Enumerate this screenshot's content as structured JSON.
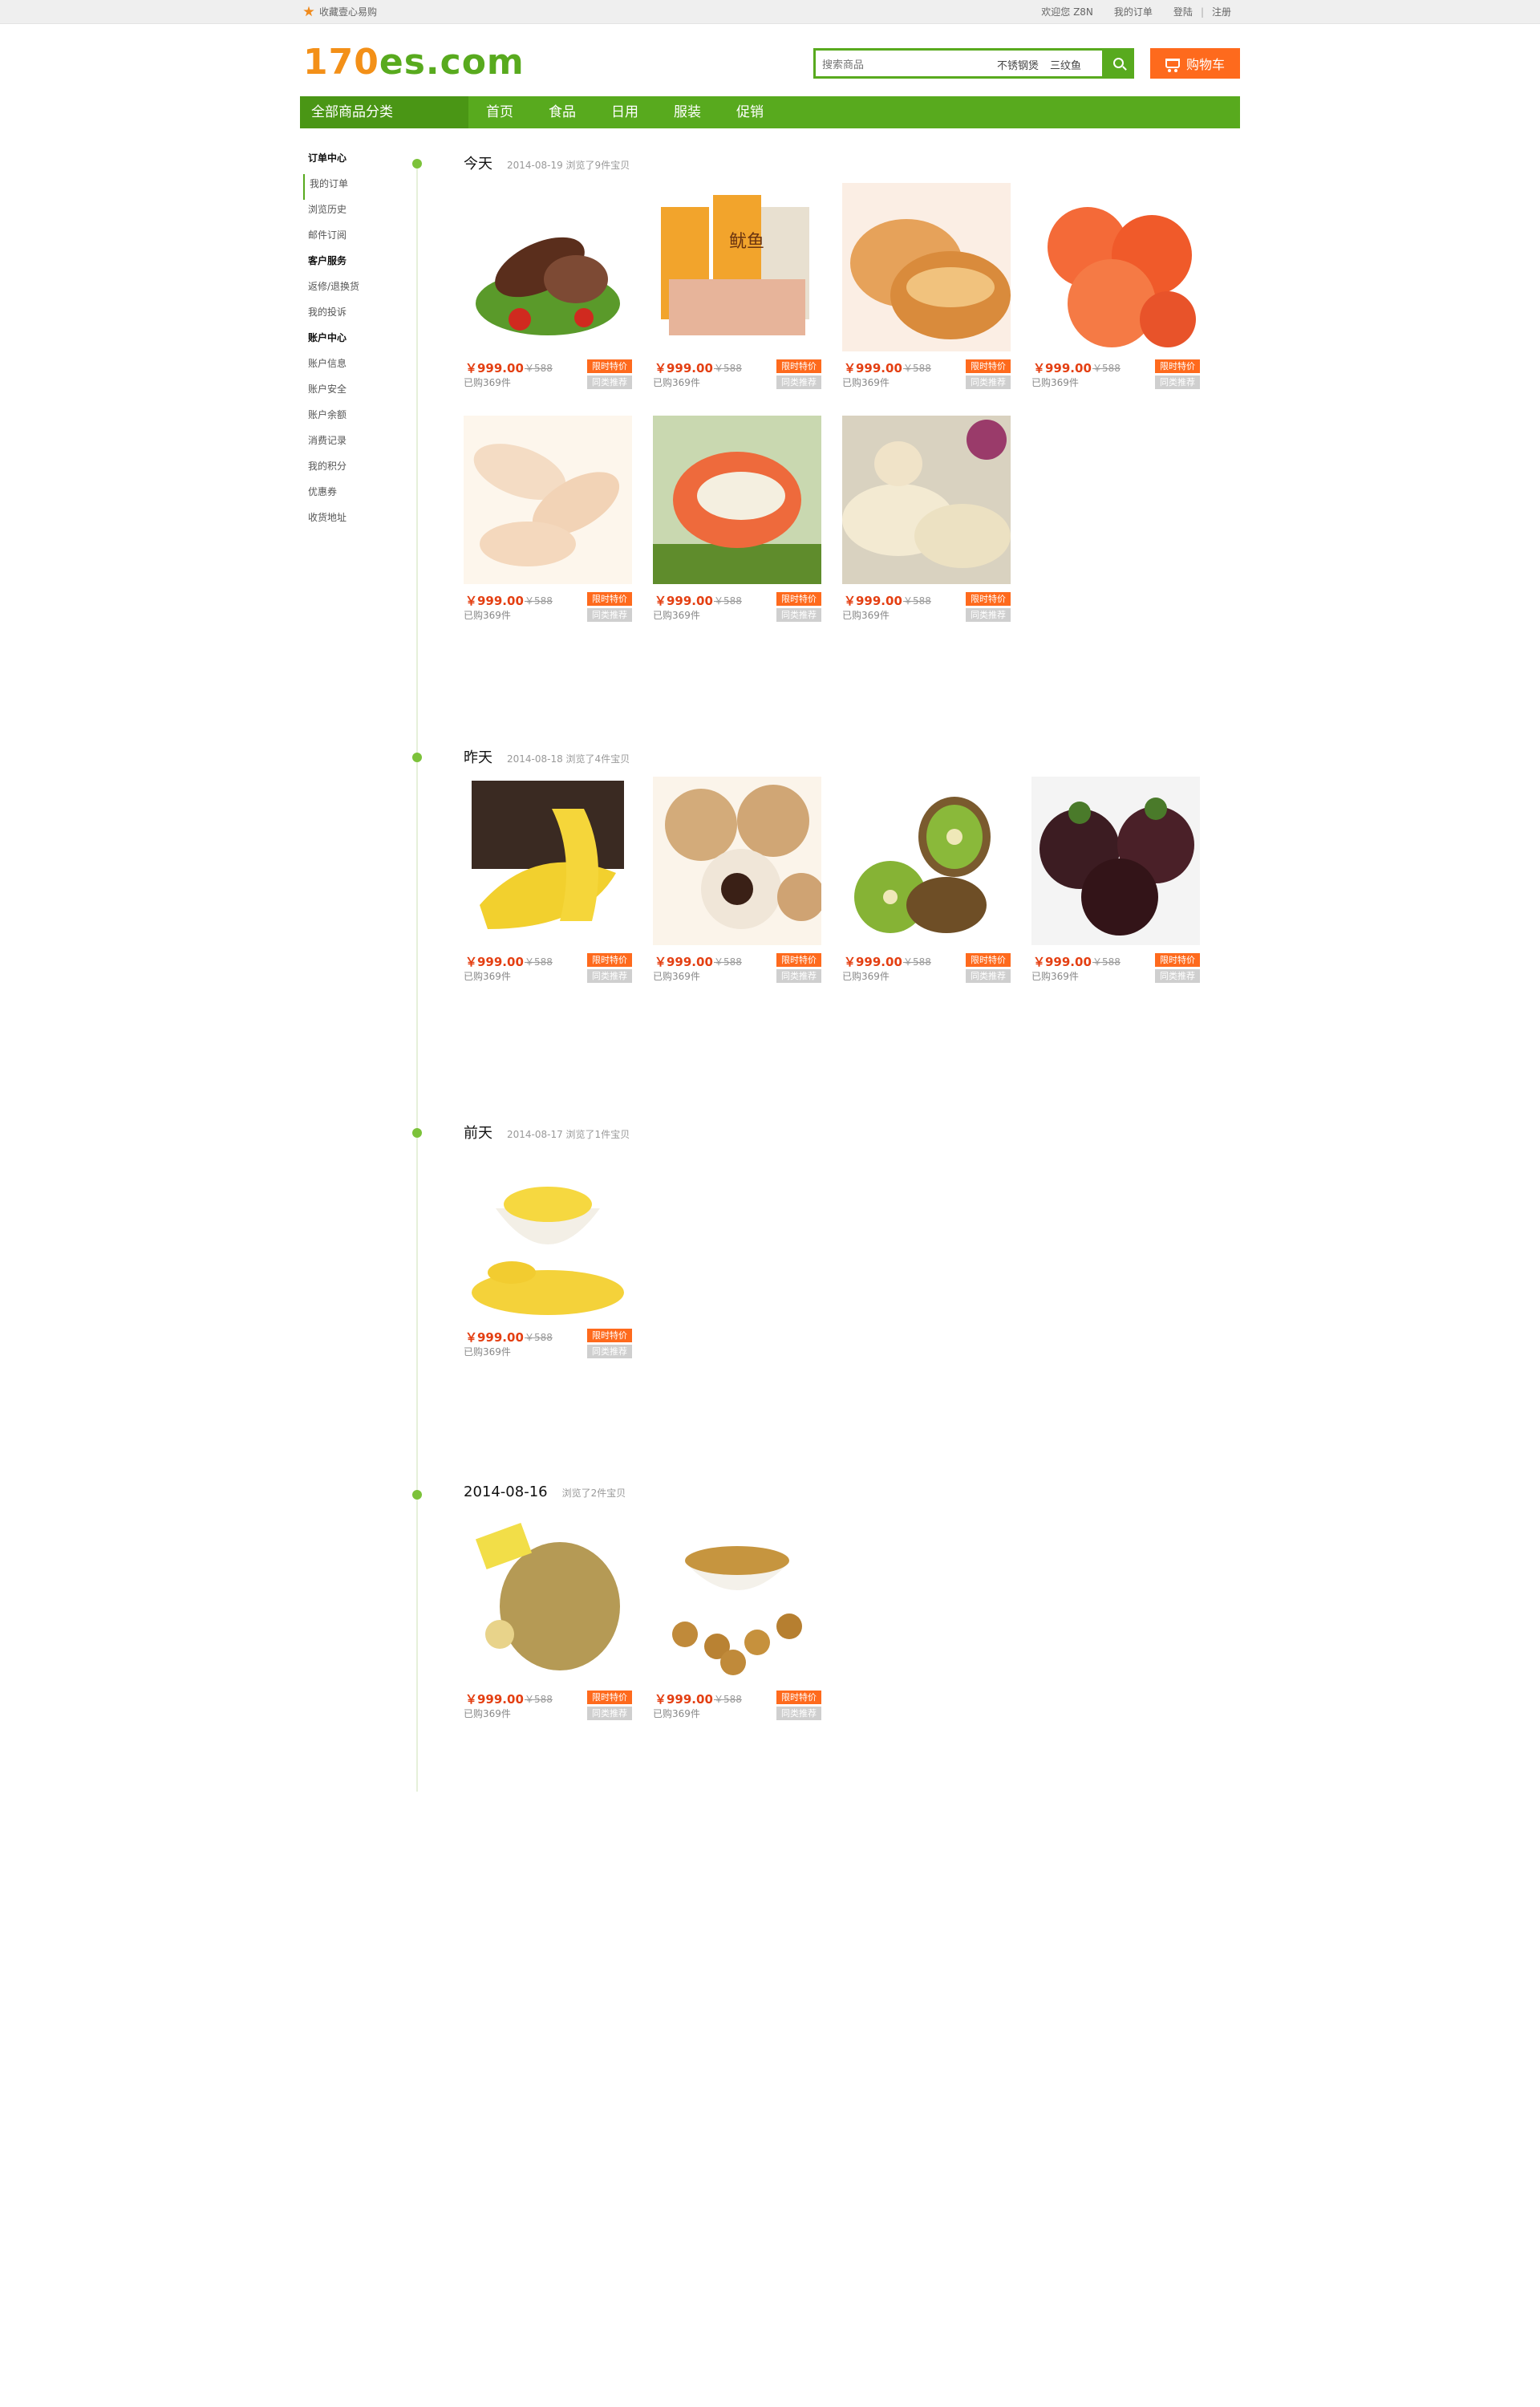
{
  "topbar": {
    "favorite": "收藏壹心易购",
    "welcome": "欢迎您 Z8N",
    "orders": "我的订单",
    "login": "登陆",
    "sep": "|",
    "register": "注册"
  },
  "logo": {
    "num": "170",
    "rest": "es.com"
  },
  "search": {
    "placeholder": "搜索商品",
    "hot": [
      "不锈钢煲",
      "三纹鱼"
    ]
  },
  "cart": {
    "label": "购物车"
  },
  "nav": {
    "all": "全部商品分类",
    "links": [
      "首页",
      "食品",
      "日用",
      "服装",
      "促销"
    ]
  },
  "sidebar": [
    {
      "label": "订单中心",
      "head": true
    },
    {
      "label": "我的订单",
      "active": true
    },
    {
      "label": "浏览历史"
    },
    {
      "label": "邮件订阅"
    },
    {
      "label": "客户服务",
      "head": true
    },
    {
      "label": "返修/退换货"
    },
    {
      "label": "我的投诉"
    },
    {
      "label": "账户中心",
      "head": true
    },
    {
      "label": "账户信息"
    },
    {
      "label": "账户安全"
    },
    {
      "label": "账户余额"
    },
    {
      "label": "消费记录"
    },
    {
      "label": "我的积分"
    },
    {
      "label": "优惠券"
    },
    {
      "label": "收货地址"
    }
  ],
  "product_common": {
    "price": "￥999.00",
    "old": "￥588",
    "sold": "已购369件",
    "tag_sale": "限时特价",
    "tag_similar": "同类推荐"
  },
  "sections": [
    {
      "title": "今天",
      "sub": "2014-08-19 浏览了9件宝贝",
      "products": [
        "sausage",
        "squid",
        "pastry",
        "shrimp",
        "prawn",
        "lobster",
        "dumpling"
      ]
    },
    {
      "title": "昨天",
      "sub": "2014-08-18 浏览了4件宝贝",
      "products": [
        "banana",
        "longan",
        "kiwi",
        "mangosteen"
      ]
    },
    {
      "title": "前天",
      "sub": "2014-08-17 浏览了1件宝贝",
      "products": [
        "corn"
      ]
    },
    {
      "title": "2014-08-16",
      "sub": "浏览了2件宝贝",
      "products": [
        "durian",
        "longan-bowl"
      ]
    }
  ],
  "colors": {
    "green": "#58aa1e",
    "orange": "#fe6a1d",
    "logo_orange": "#f39018"
  }
}
